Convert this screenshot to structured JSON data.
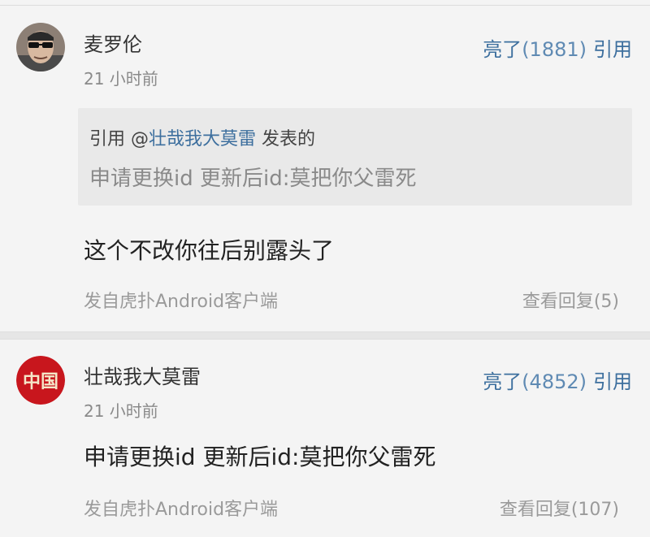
{
  "comments": [
    {
      "username": "麦罗伦",
      "time": "21 小时前",
      "like_label": "亮了",
      "like_count": "(1881)",
      "quote_label": "引用",
      "quote": {
        "prefix": "引用 @",
        "user": "壮哉我大莫雷",
        "suffix": " 发表的",
        "text": "申请更换id 更新后id:莫把你父雷死"
      },
      "content": "这个不改你往后别露头了",
      "source": "发自虎扑Android客户端",
      "replies": "查看回复(5)"
    },
    {
      "username": "壮哉我大莫雷",
      "time": "21 小时前",
      "like_label": "亮了",
      "like_count": "(4852)",
      "quote_label": "引用",
      "content": "申请更换id 更新后id:莫把你父雷死",
      "source": "发自虎扑Android客户端",
      "replies": "查看回复(107)",
      "avatar_text": "中国"
    }
  ],
  "colors": {
    "link": "#3d6f9e",
    "background": "#f4f4f4",
    "quote_bg": "#e9e9e9",
    "muted": "#9a9a9a",
    "avatar2_red": "#c8161d"
  }
}
